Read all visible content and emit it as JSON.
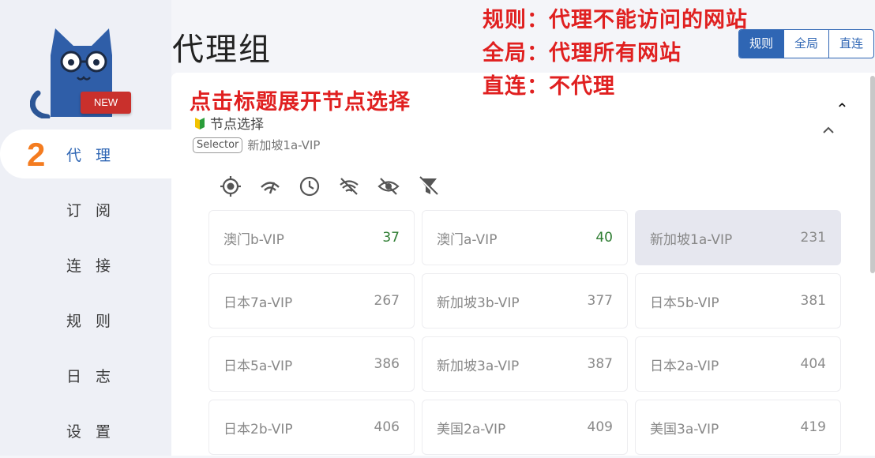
{
  "sidebar": {
    "badge": "NEW",
    "delay_number": "2",
    "items": [
      {
        "label": "代 理",
        "active": true
      },
      {
        "label": "订 阅",
        "active": false
      },
      {
        "label": "连 接",
        "active": false
      },
      {
        "label": "规 则",
        "active": false
      },
      {
        "label": "日 志",
        "active": false
      },
      {
        "label": "设 置",
        "active": false
      }
    ]
  },
  "header": {
    "title": "代理组",
    "mode_tabs": [
      {
        "label": "规则",
        "active": true
      },
      {
        "label": "全局",
        "active": false
      },
      {
        "label": "直连",
        "active": false
      }
    ]
  },
  "annotations": {
    "rule": "规则：代理不能访问的网站",
    "global": "全局：代理所有网站",
    "direct": "直连：不代理",
    "click_hint": "点击标题展开节点选择"
  },
  "group": {
    "icon": "beginner-leaf-icon",
    "name": "节点选择",
    "type": "Selector",
    "current": "新加坡1a-VIP"
  },
  "toolbar": [
    "locate-icon",
    "speed-test-icon",
    "clock-sort-icon",
    "filter-unavailable-icon",
    "hide-icon",
    "filter-off-icon"
  ],
  "proxies": [
    {
      "name": "澳门b-VIP",
      "delay": "37",
      "good": true,
      "selected": false
    },
    {
      "name": "澳门a-VIP",
      "delay": "40",
      "good": true,
      "selected": false
    },
    {
      "name": "新加坡1a-VIP",
      "delay": "231",
      "good": false,
      "selected": true
    },
    {
      "name": "日本7a-VIP",
      "delay": "267",
      "good": false,
      "selected": false
    },
    {
      "name": "新加坡3b-VIP",
      "delay": "377",
      "good": false,
      "selected": false
    },
    {
      "name": "日本5b-VIP",
      "delay": "381",
      "good": false,
      "selected": false
    },
    {
      "name": "日本5a-VIP",
      "delay": "386",
      "good": false,
      "selected": false
    },
    {
      "name": "新加坡3a-VIP",
      "delay": "387",
      "good": false,
      "selected": false
    },
    {
      "name": "日本2a-VIP",
      "delay": "404",
      "good": false,
      "selected": false
    },
    {
      "name": "日本2b-VIP",
      "delay": "406",
      "good": false,
      "selected": false
    },
    {
      "name": "美国2a-VIP",
      "delay": "409",
      "good": false,
      "selected": false
    },
    {
      "name": "美国3a-VIP",
      "delay": "419",
      "good": false,
      "selected": false
    }
  ],
  "colors": {
    "accent": "#2f66b4",
    "annotation": "#e02020",
    "delay_good": "#2e7d32",
    "delay_number": "#f47c20"
  }
}
